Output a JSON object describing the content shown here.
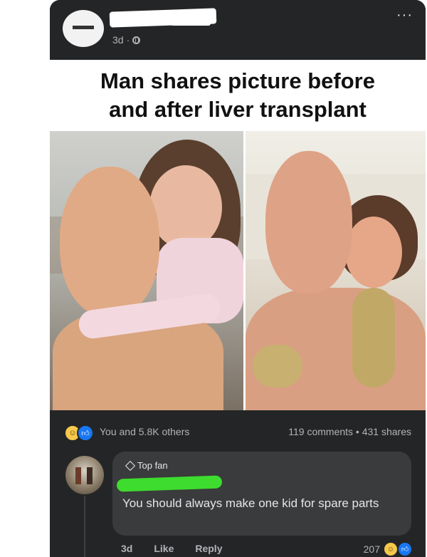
{
  "post": {
    "time": "3d",
    "separator": "·",
    "more": "···",
    "headline_line1": "Man shares picture before",
    "headline_line2": "and after liver transplant"
  },
  "stats": {
    "reactions_text": "You and 5.8K others",
    "comments": "119 comments",
    "dot": "•",
    "shares": "431 shares",
    "reaction_icons": [
      "haha-icon",
      "like-icon"
    ]
  },
  "comment": {
    "badge": "Top fan",
    "text": "You should always make one kid for spare parts",
    "time": "3d",
    "like_label": "Like",
    "reply_label": "Reply",
    "reaction_count": "207"
  },
  "colors": {
    "card": "#242526",
    "bubble": "#3a3b3c",
    "secondary_text": "#b0b3b8",
    "like_blue": "#1877f2",
    "redact_green": "#3ddc2e"
  }
}
